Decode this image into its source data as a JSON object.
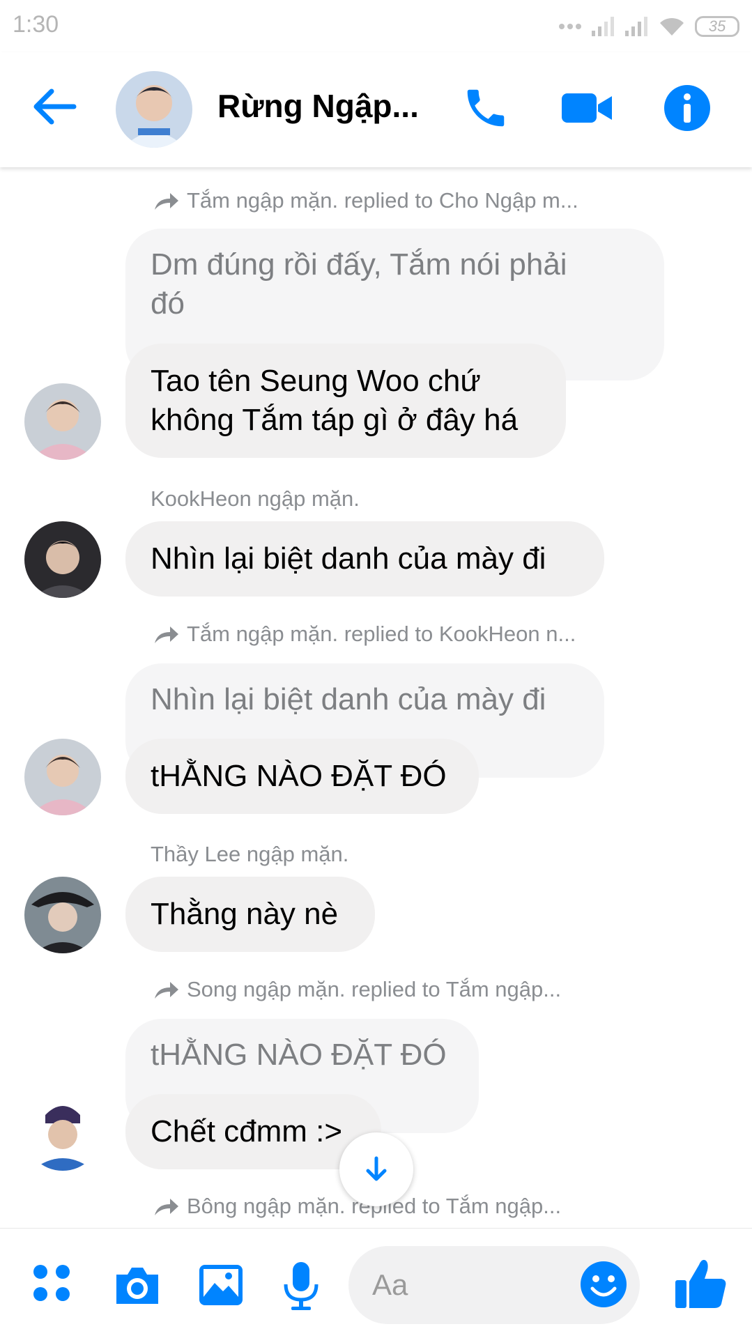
{
  "status_bar": {
    "time": "1:30",
    "battery": "35"
  },
  "header": {
    "title": "Rừng Ngập..."
  },
  "messages": {
    "m1": {
      "reply_note": "Tắm ngập mặn. replied to Cho Ngập m...",
      "quoted_line1": "Dm đúng rồi đấy, Tắm nói phải",
      "quoted_line2": "đó",
      "text_line1": "Tao tên Seung Woo chứ",
      "text_line2": "không Tắm táp gì ở đây há"
    },
    "m2": {
      "sender": "KookHeon ngập mặn.",
      "text": "Nhìn lại biệt danh của mày đi"
    },
    "m3": {
      "reply_note": "Tắm ngập mặn. replied to KookHeon n...",
      "quoted": "Nhìn lại biệt danh của mày đi",
      "text": "tHẰNG NÀO ĐẶT ĐÓ"
    },
    "m4": {
      "sender": "Thầy Lee ngập mặn.",
      "text": "Thằng này nè"
    },
    "m5": {
      "reply_note": "Song ngập mặn. replied to Tắm ngập...",
      "quoted": "tHẰNG NÀO ĐẶT ĐÓ",
      "text": "Chết cđmm :>"
    },
    "m6": {
      "reply_note": "Bông ngập mặn. replied to Tắm ngập..."
    }
  },
  "composer": {
    "placeholder": "Aa"
  },
  "colors": {
    "accent": "#0084ff",
    "bubble": "#f1f0f0",
    "meta_text": "#8a8d91"
  },
  "icons": [
    "back-arrow-icon",
    "phone-icon",
    "video-camera-icon",
    "info-icon",
    "reply-arrow-icon",
    "scroll-down-icon",
    "apps-icon",
    "camera-icon",
    "gallery-icon",
    "microphone-icon",
    "emoji-icon",
    "thumbs-up-icon"
  ]
}
